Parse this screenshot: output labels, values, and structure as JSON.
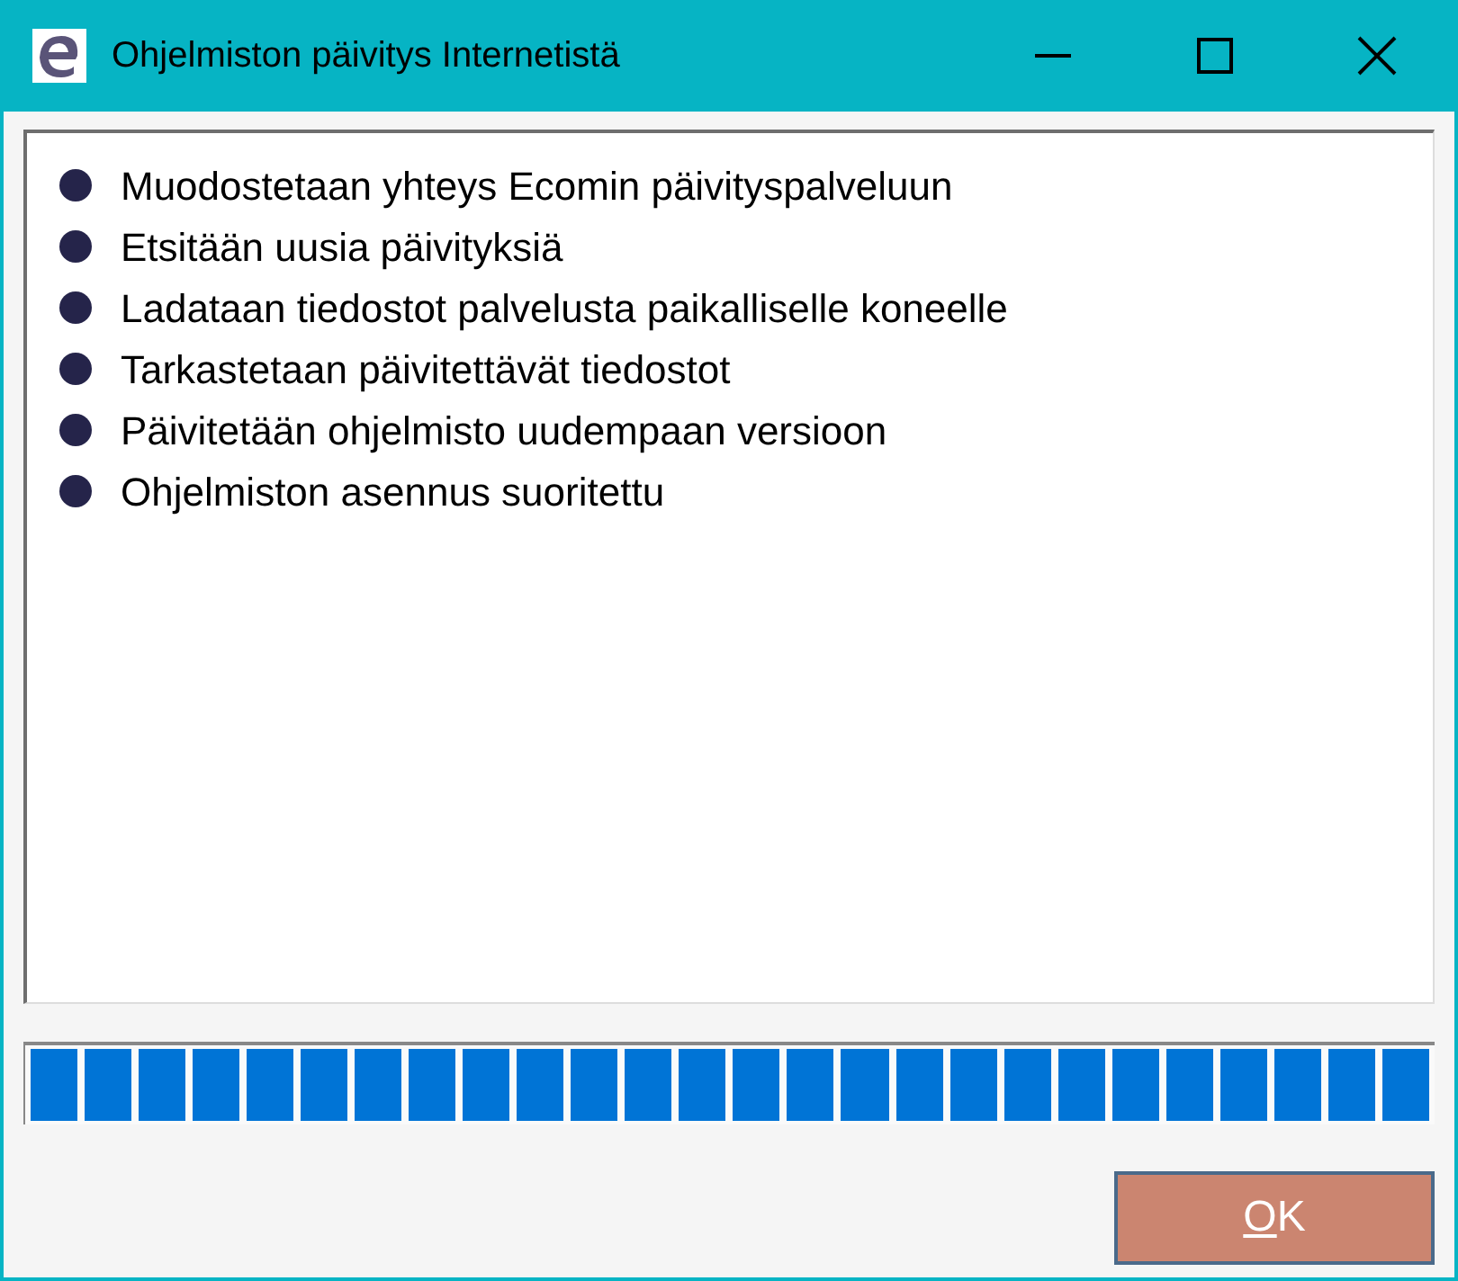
{
  "window": {
    "title": "Ohjelmiston päivitys Internetistä"
  },
  "steps": [
    "Muodostetaan yhteys Ecomin päivityspalveluun",
    "Etsitään uusia päivityksiä",
    "Ladataan tiedostot palvelusta paikalliselle koneelle",
    "Tarkastetaan päivitettävät tiedostot",
    "Päivitetään ohjelmisto uudempaan versioon",
    "Ohjelmiston asennus suoritettu"
  ],
  "progress": {
    "level": 1
  },
  "buttons": [
    "OK"
  ]
}
